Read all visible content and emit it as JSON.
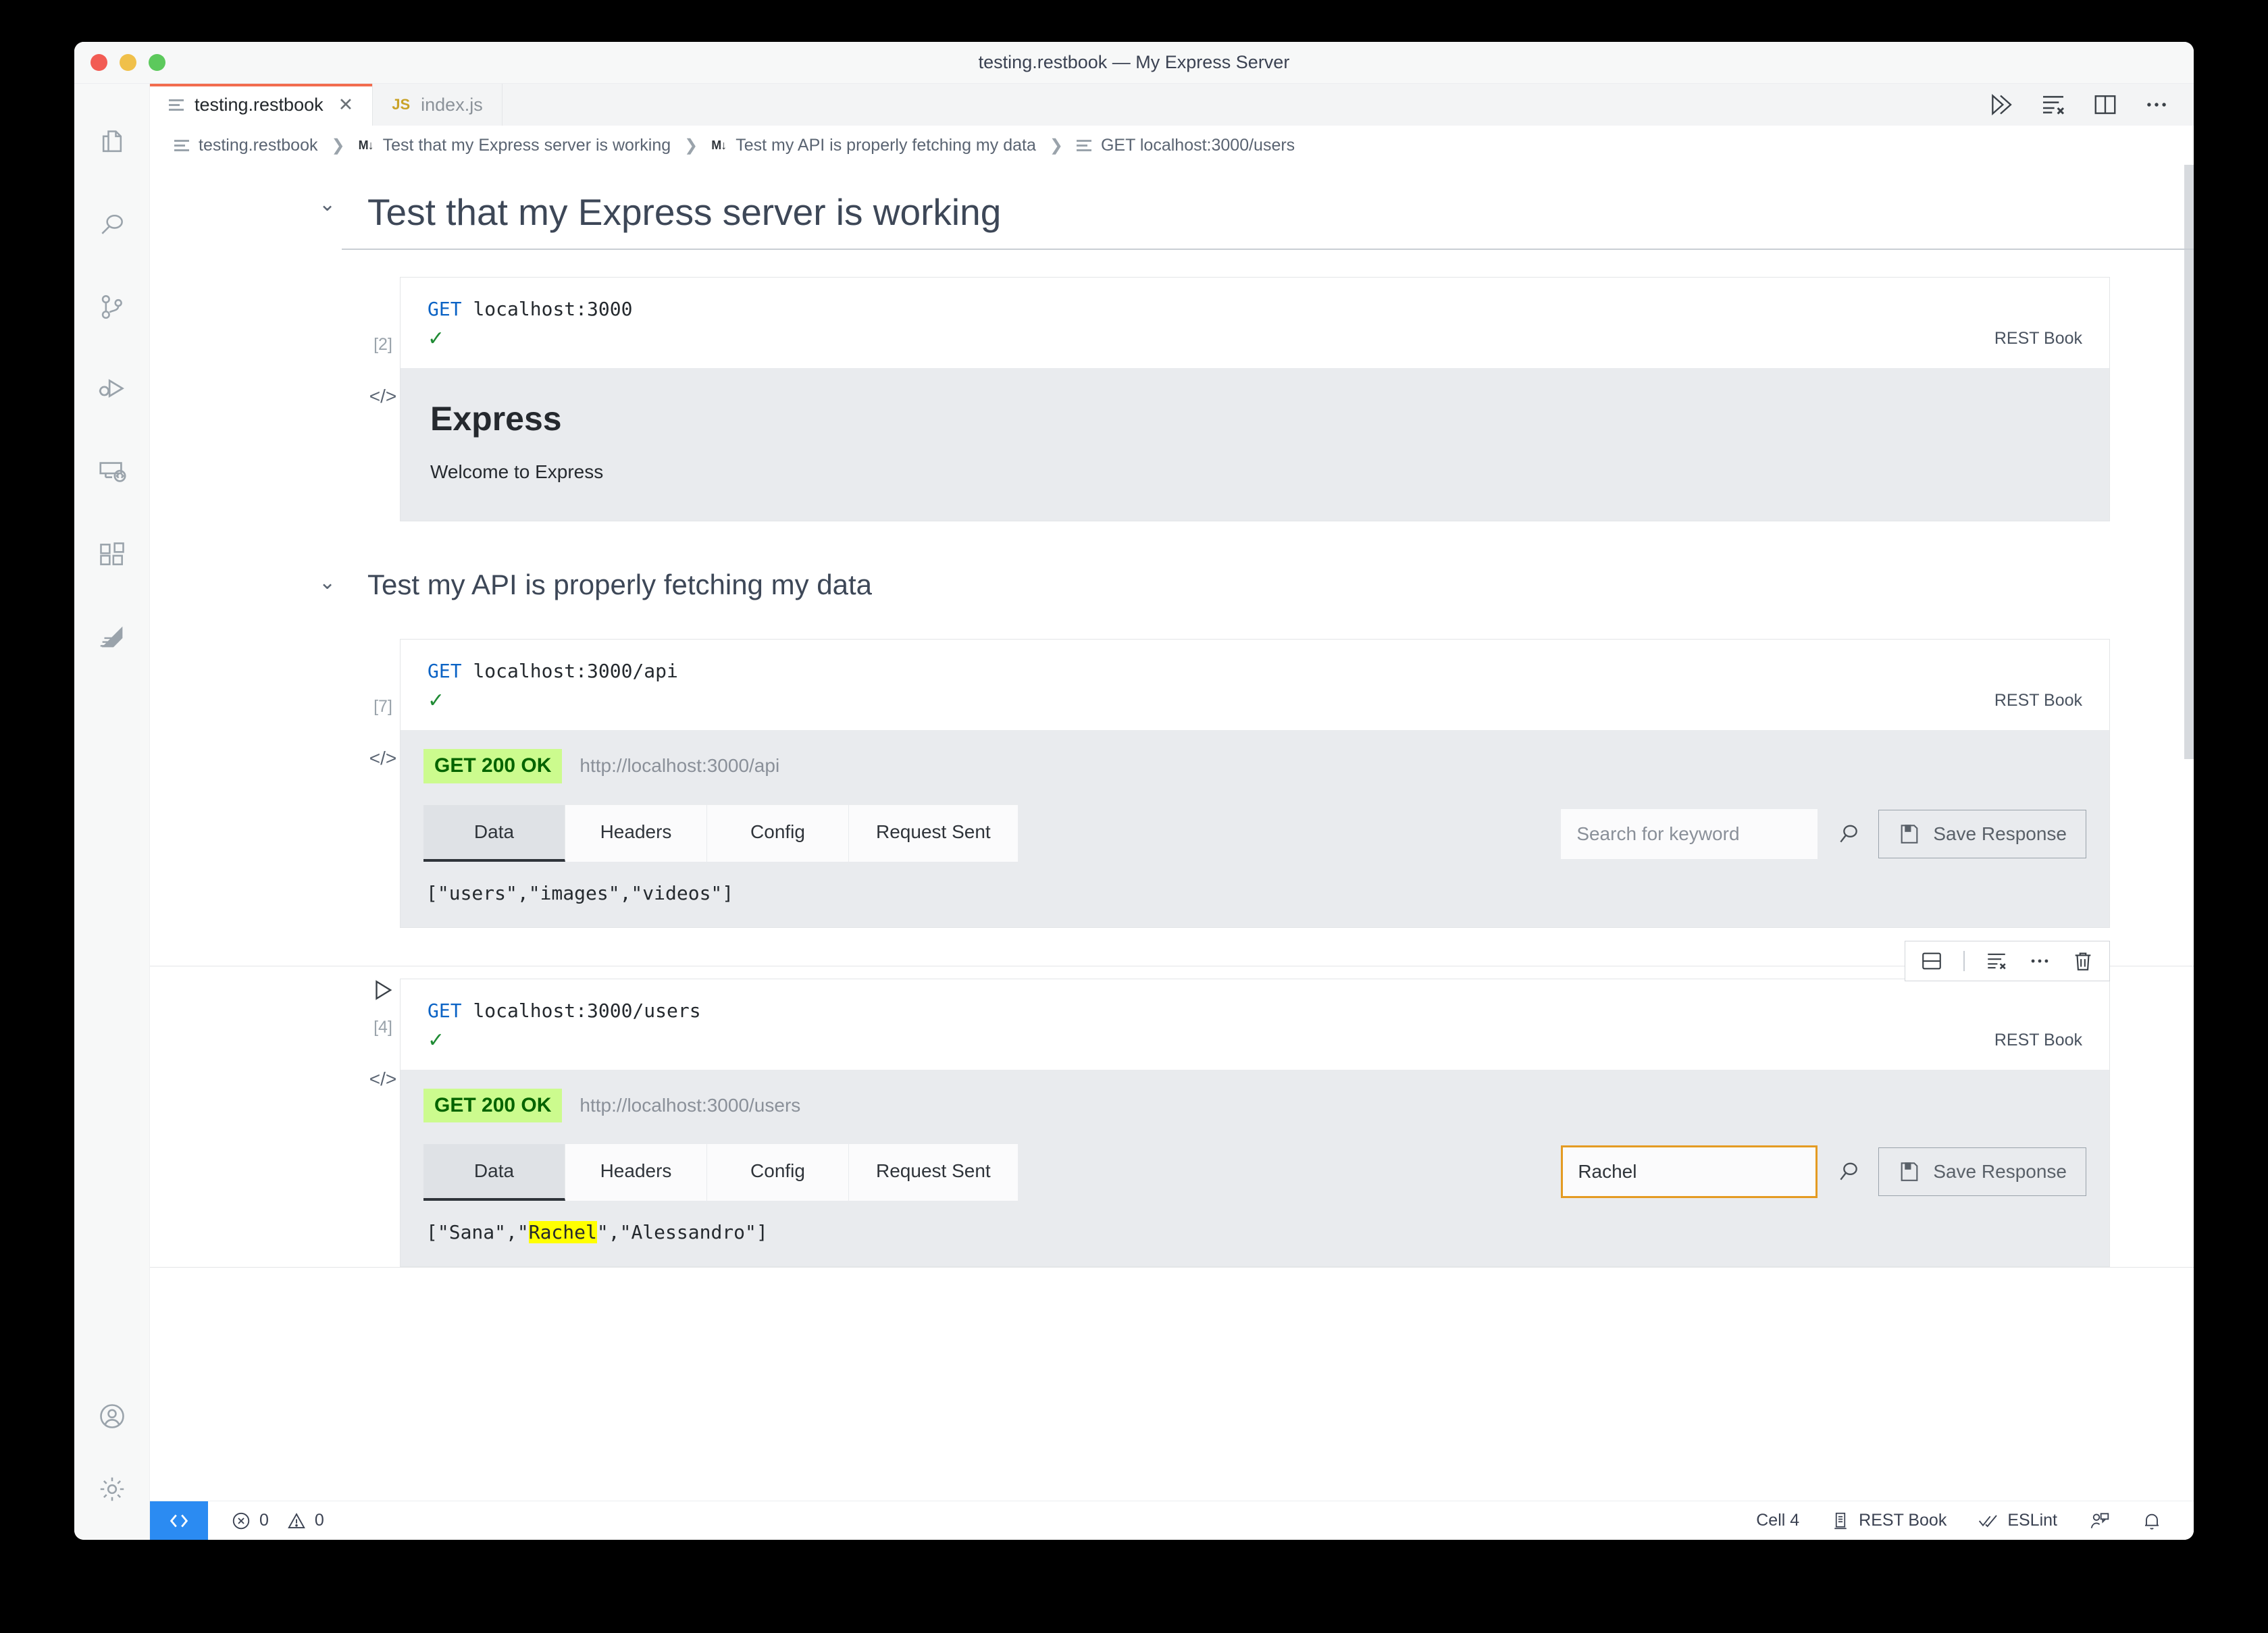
{
  "window": {
    "title": "testing.restbook — My Express Server"
  },
  "activity_bar": {
    "items": [
      {
        "name": "explorer",
        "icon": "files-icon"
      },
      {
        "name": "search",
        "icon": "search-icon"
      },
      {
        "name": "source-control",
        "icon": "source-control-icon"
      },
      {
        "name": "run-and-debug",
        "icon": "run-debug-icon"
      },
      {
        "name": "remote-explorer",
        "icon": "remote-explorer-icon"
      },
      {
        "name": "extensions",
        "icon": "extensions-icon"
      },
      {
        "name": "rest-book",
        "icon": "rest-book-icon"
      }
    ],
    "bottom": [
      {
        "name": "accounts",
        "icon": "account-icon"
      },
      {
        "name": "manage",
        "icon": "gear-icon"
      }
    ]
  },
  "tabs": [
    {
      "label": "testing.restbook",
      "icon": "notebook-icon",
      "active": true,
      "closeable": true
    },
    {
      "label": "index.js",
      "icon": "js-icon",
      "active": false,
      "closeable": false
    }
  ],
  "editor_actions": [
    {
      "name": "run-all-cells",
      "icon": "run-all-icon"
    },
    {
      "name": "clear-all-outputs",
      "icon": "clear-outputs-icon"
    },
    {
      "name": "split-editor",
      "icon": "split-editor-icon"
    },
    {
      "name": "more-actions",
      "icon": "ellipsis-icon"
    }
  ],
  "breadcrumb": [
    {
      "label": "testing.restbook",
      "icon": "notebook-icon"
    },
    {
      "label": "Test that my Express server is working",
      "icon": "markdown-icon"
    },
    {
      "label": "Test my API is properly fetching my data",
      "icon": "markdown-icon"
    },
    {
      "label": "GET localhost:3000/users",
      "icon": "notebook-icon"
    }
  ],
  "notebook": {
    "sections": [
      {
        "heading": "Test that my Express server is working",
        "level": 1
      },
      {
        "heading": "Test my API is properly fetching my data",
        "level": 2
      }
    ],
    "cells": [
      {
        "id": "cell-1",
        "method": "GET",
        "url": "localhost:3000",
        "execution_count": "[2]",
        "status_glyph": "✓",
        "kernel": "REST Book",
        "output_type": "html",
        "html_output": {
          "heading": "Express",
          "body": "Welcome to Express"
        }
      },
      {
        "id": "cell-2",
        "method": "GET",
        "url": "localhost:3000/api",
        "execution_count": "[7]",
        "status_glyph": "✓",
        "kernel": "REST Book",
        "output_type": "rest-response",
        "response": {
          "badge": "GET 200 OK",
          "url": "http://localhost:3000/api",
          "tabs": [
            "Data",
            "Headers",
            "Config",
            "Request Sent"
          ],
          "active_tab": "Data",
          "search_value": "",
          "search_placeholder": "Search for keyword",
          "search_focused": false,
          "save_label": "Save Response",
          "data": "[\"users\",\"images\",\"videos\"]",
          "highlight": null
        }
      },
      {
        "id": "cell-3",
        "method": "GET",
        "url": "localhost:3000/users",
        "execution_count": "[4]",
        "status_glyph": "✓",
        "kernel": "REST Book",
        "hovered": true,
        "toolbar": [
          {
            "name": "split-cell",
            "icon": "split-cell-icon"
          },
          {
            "name": "clear-cell-outputs",
            "icon": "clear-outputs-icon"
          },
          {
            "name": "more-cell-actions",
            "icon": "ellipsis-icon"
          },
          {
            "name": "delete-cell",
            "icon": "trash-icon"
          }
        ],
        "output_type": "rest-response",
        "response": {
          "badge": "GET 200 OK",
          "url": "http://localhost:3000/users",
          "tabs": [
            "Data",
            "Headers",
            "Config",
            "Request Sent"
          ],
          "active_tab": "Data",
          "search_value": "Rachel",
          "search_placeholder": "Search for keyword",
          "search_focused": true,
          "save_label": "Save Response",
          "data_prefix": "[\"Sana\",\"",
          "data_highlight": "Rachel",
          "data_suffix": "\",\"Alessandro\"]"
        }
      }
    ]
  },
  "status_bar": {
    "remote_icon": "remote-icon",
    "errors": "0",
    "warnings": "0",
    "cell_indicator": "Cell 4",
    "kernel": "REST Book",
    "eslint": "ESLint",
    "right_icons": [
      {
        "name": "live-share",
        "icon": "live-share-icon"
      },
      {
        "name": "notifications",
        "icon": "bell-icon"
      }
    ]
  },
  "colors": {
    "tab_accent": "#f26c4f",
    "status_badge_bg": "#ccfb8e",
    "status_badge_fg": "#036400",
    "highlight": "#ffff00",
    "focus_border": "#e49b22",
    "remote_bg": "#2b8bf2"
  }
}
